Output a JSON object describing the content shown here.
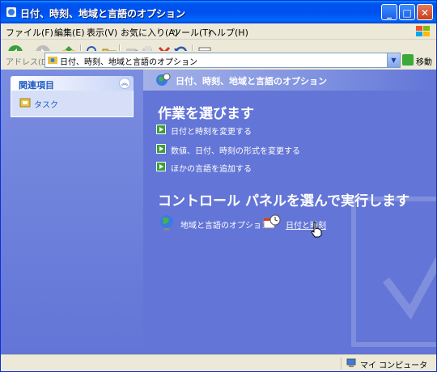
{
  "window": {
    "title": "日付、時刻、地域と言語のオプション",
    "buttons": {
      "minimize": "_",
      "maximize": "□",
      "close": "✕"
    }
  },
  "menu": {
    "items": [
      "ファイル(F)",
      "編集(E)",
      "表示(V)",
      "お気に入り(A)",
      "ツール(T)",
      "ヘルプ(H)"
    ]
  },
  "address": {
    "label": "アドレス(D)",
    "value": "日付、時刻、地域と言語のオプション",
    "go_label": "移動"
  },
  "sidebar": {
    "panel_title": "関連項目",
    "items": [
      {
        "label": "タスク",
        "icon": "task-icon"
      }
    ]
  },
  "main": {
    "header_title": "日付、時刻、地域と言語のオプション",
    "task_heading": "作業を選びます",
    "tasks": [
      {
        "label": "日付と時刻を変更する"
      },
      {
        "label": "数値、日付、時刻の形式を変更する"
      },
      {
        "label": "ほかの言語を追加する"
      }
    ],
    "cp_heading": "コントロール パネルを選んで実行します",
    "cp_items": [
      {
        "label": "地域と言語のオプション",
        "icon": "globe-icon"
      },
      {
        "label": "日付と時刻",
        "icon": "clock-calendar-icon"
      }
    ]
  },
  "status": {
    "zone_label": "マイ コンピュータ"
  },
  "colors": {
    "title_bar": "#0053ee",
    "content_bg": "#6375d6",
    "link": "#215dc6",
    "task_arrow": "#3aa03a"
  }
}
